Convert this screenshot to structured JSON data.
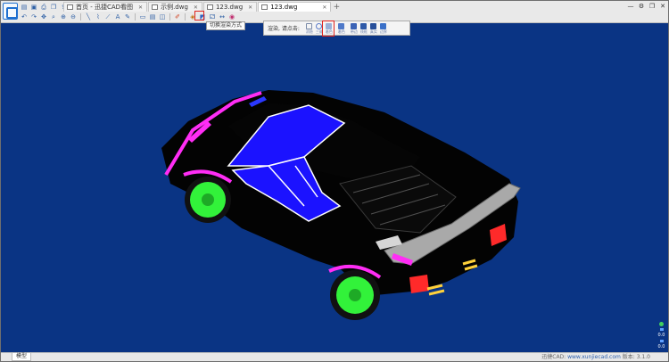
{
  "colors": {
    "viewport_bg": "#0a3484",
    "car_body": "#030303",
    "glass": "#1b12ff",
    "wheel": "#32f23a",
    "accent_magenta": "#ff2df5",
    "spoiler": "#a9a9a9",
    "tail_light": "#ff2a2a",
    "exhaust": "#ffd13a",
    "highlight_red": "#e0231e"
  },
  "toolbar": {
    "row1_icons": [
      "open-folder-icon",
      "save-icon",
      "print-icon",
      "copy-icon",
      "export-icon",
      "home-icon"
    ],
    "row2_icons": [
      "undo-icon",
      "redo-icon",
      "pan-icon",
      "zoom-window-icon",
      "zoom-in-icon",
      "zoom-out-icon",
      "line-icon",
      "polyline-icon",
      "measure-icon",
      "text-icon",
      "rectangle-icon",
      "layer-icon",
      "pen-icon",
      "3d-icon",
      "render-mode-icon",
      "rotate-icon",
      "color-icon"
    ]
  },
  "tabs": [
    {
      "label": "首页 - 迅捷CAD看图",
      "active": false
    },
    {
      "label": "示例.dwg",
      "active": false
    },
    {
      "label": "123.dwg",
      "active": false
    },
    {
      "label": "123.dwg",
      "active": true
    }
  ],
  "window": {
    "minimize": "—",
    "settings": "⚙",
    "restore": "❐",
    "close": "✕"
  },
  "tooltip": "切换渲染方式",
  "render_panel": {
    "title": "渲染, 请点击:",
    "buttons": [
      {
        "label": "消隐",
        "icon": "hidden-line-icon"
      },
      {
        "label": "三维",
        "icon": "wireframe-3d-icon"
      },
      {
        "label": "着色",
        "icon": "flat-shade-icon"
      },
      {
        "label": "着色",
        "icon": "gouraud-shade-icon",
        "selected": true
      },
      {
        "label": "带边",
        "icon": "shade-edges-icon"
      },
      {
        "label": "线框",
        "icon": "wire-icon"
      },
      {
        "label": "真实",
        "icon": "realistic-icon"
      },
      {
        "label": "边界",
        "icon": "boundary-icon"
      }
    ]
  },
  "status": {
    "model_tab": "模型",
    "brand": "迅捷CAD:",
    "link": "www.xunjiecad.com",
    "version": "版本: 3.1.0"
  },
  "zoom_widget": {
    "label_top": "0.0",
    "label_mid": "0.0"
  }
}
